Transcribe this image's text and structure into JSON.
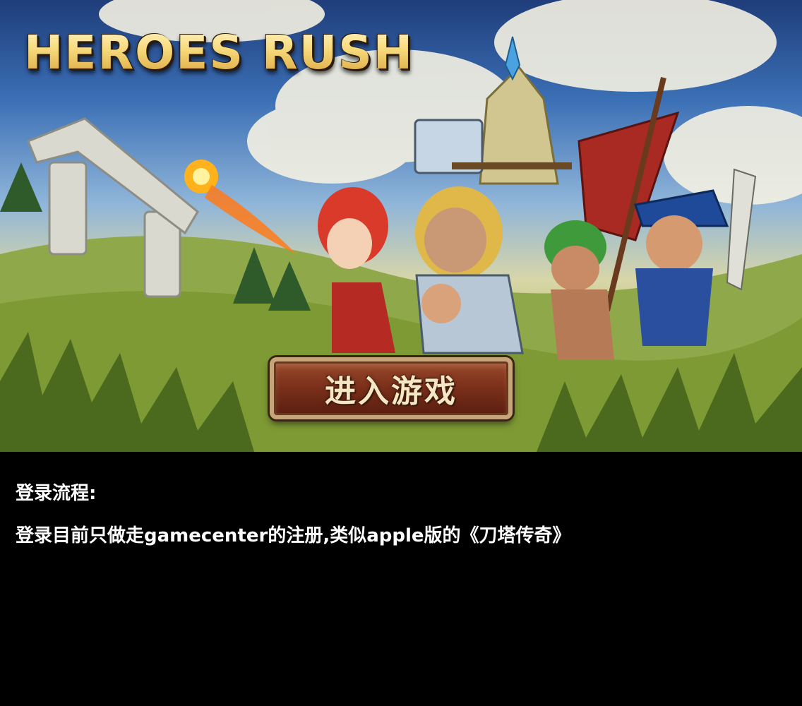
{
  "splash": {
    "logo_text": "HEROES RUSH",
    "enter_button_label": "进入游戏",
    "colors": {
      "logo_gold": "#f6d97a",
      "button_brown": "#7a2f1a",
      "button_border": "#c7a57a",
      "sky_blue": "#3b6fb5",
      "grass_green": "#6e8a2c"
    }
  },
  "notes": {
    "heading": "登录流程:",
    "body": "登录目前只做走gamecenter的注册,类似apple版的《刀塔传奇》",
    "background_color": "#000000",
    "text_color": "#ffffff"
  }
}
